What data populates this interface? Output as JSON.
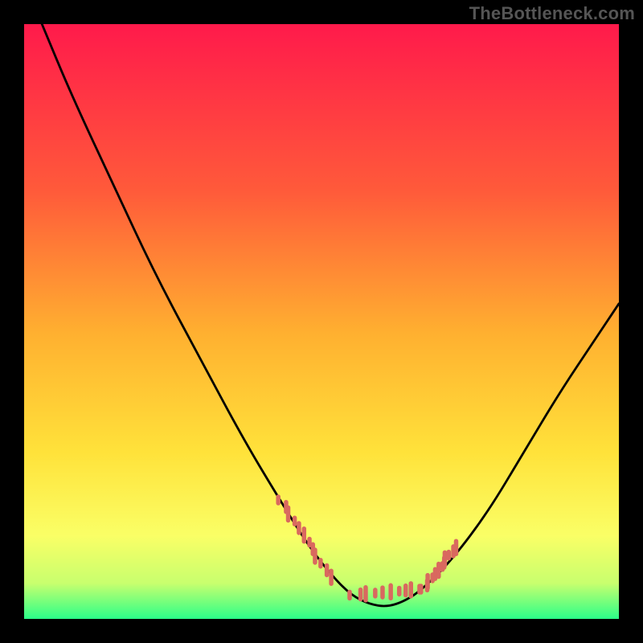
{
  "watermark": "TheBottleneck.com",
  "colors": {
    "page_bg": "#000000",
    "grad_top": "#ff1a4b",
    "grad_q1": "#ff5a3a",
    "grad_mid": "#ffb030",
    "grad_q3": "#ffe23a",
    "grad_low": "#faff66",
    "grad_base_hi": "#c8ff6e",
    "grad_base_lo": "#2bff89",
    "curve": "#000000",
    "tick_marker": "#d9695f"
  },
  "chart_data": {
    "type": "line",
    "title": "",
    "xlabel": "",
    "ylabel": "",
    "xlim": [
      0,
      100
    ],
    "ylim": [
      0,
      100
    ],
    "series": [
      {
        "name": "curve",
        "x": [
          3,
          8,
          15,
          22,
          30,
          37,
          43,
          48,
          52,
          55,
          58,
          61,
          64,
          67,
          72,
          78,
          84,
          90,
          96,
          100
        ],
        "y": [
          100,
          88,
          73,
          58,
          43,
          30,
          20,
          12,
          7,
          4,
          2.5,
          2,
          3,
          5,
          10,
          18,
          28,
          38,
          47,
          53
        ]
      }
    ],
    "markers_left": {
      "x_range": [
        43,
        52
      ],
      "y_range": [
        20,
        7
      ],
      "count": 12
    },
    "markers_bottom": {
      "x_range": [
        55,
        67
      ],
      "y_range": [
        4,
        5
      ],
      "count": 10
    },
    "markers_right": {
      "x_range": [
        67,
        73
      ],
      "y_range": [
        5,
        12
      ],
      "count": 12
    }
  }
}
